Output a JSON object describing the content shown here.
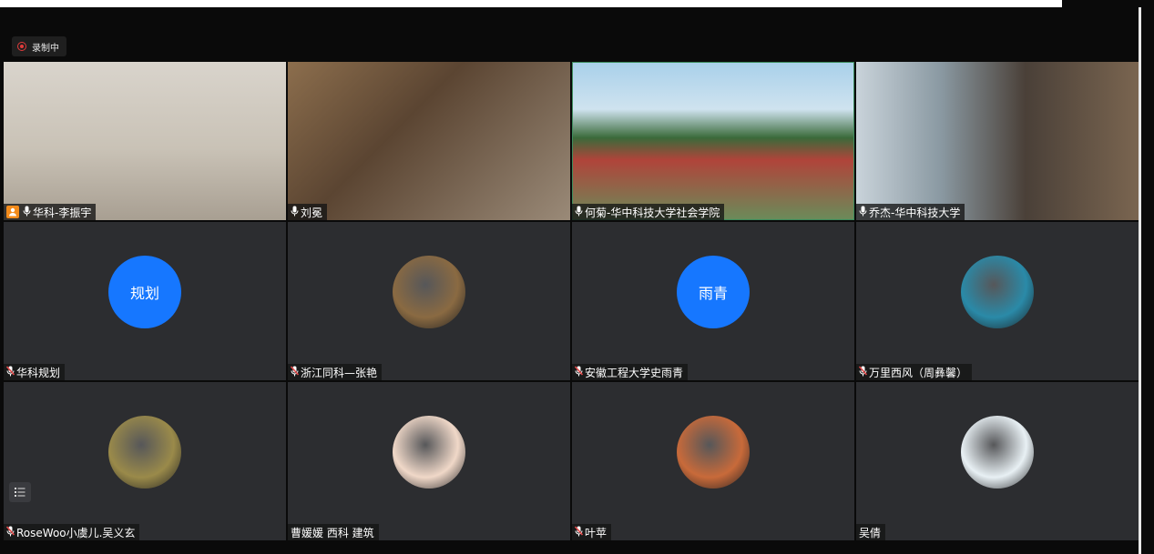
{
  "recording": {
    "label": "录制中"
  },
  "participants": [
    {
      "name": "华科-李振宇",
      "host": true,
      "mic": "on",
      "kind": "video",
      "bg": "bg1"
    },
    {
      "name": "刘冕",
      "host": false,
      "mic": "on",
      "kind": "video",
      "bg": "bg2"
    },
    {
      "name": "何菊-华中科技大学社会学院",
      "host": false,
      "mic": "on",
      "kind": "video",
      "bg": "bg3"
    },
    {
      "name": "乔杰-华中科技大学",
      "host": false,
      "mic": "on",
      "kind": "video",
      "bg": "bg4"
    },
    {
      "name": "华科规划",
      "host": false,
      "mic": "muted",
      "kind": "initials",
      "initials": "规划"
    },
    {
      "name": "浙江同科—张艳",
      "host": false,
      "mic": "muted",
      "kind": "photo",
      "color": "#8a6a42"
    },
    {
      "name": "安徽工程大学史雨青",
      "host": false,
      "mic": "muted",
      "kind": "initials",
      "initials": "雨青"
    },
    {
      "name": "万里西风（周彝馨）",
      "host": false,
      "mic": "muted",
      "kind": "photo",
      "color": "#2a8aa8"
    },
    {
      "name": "RoseWoo小虞儿.吴义玄",
      "host": false,
      "mic": "muted",
      "kind": "photo",
      "color": "#9a8a4a"
    },
    {
      "name": "曹媛媛 西科 建筑",
      "host": false,
      "mic": "none",
      "kind": "photo",
      "color": "#f0d8c8"
    },
    {
      "name": "叶苹",
      "host": false,
      "mic": "muted",
      "kind": "photo",
      "color": "#c86a3a"
    },
    {
      "name": "吴倩",
      "host": false,
      "mic": "none",
      "kind": "photo",
      "color": "#e8f0f4"
    }
  ],
  "colors": {
    "accent_blue": "#1677ff",
    "host_orange": "#f38b1b",
    "muted_red": "#e04848"
  }
}
